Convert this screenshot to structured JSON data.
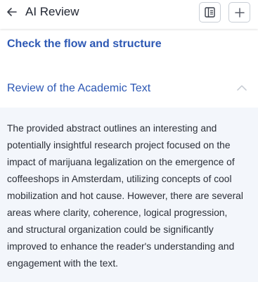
{
  "header": {
    "title": "AI Review",
    "icons": {
      "back": "arrow-left-icon",
      "panel": "side-panel-icon",
      "add": "plus-icon"
    }
  },
  "sections": {
    "flow": {
      "title": "Check the flow and structure"
    },
    "review": {
      "title": "Review of the Academic Text",
      "expanded": true,
      "body": "The provided abstract outlines an interesting and potentially insightful research project focused on the impact of marijuana legalization on the emergence of coffeeshops in Amsterdam, utilizing concepts of cool mobilization and hot cause. However, there are several areas where clarity, coherence, logical progression, and structural organization could be significantly improved to enhance the reader's understanding and engagement with the text."
    }
  },
  "colors": {
    "accent": "#2d58b4",
    "panel_bg": "#f3f6fb",
    "text": "#2b2f38"
  }
}
